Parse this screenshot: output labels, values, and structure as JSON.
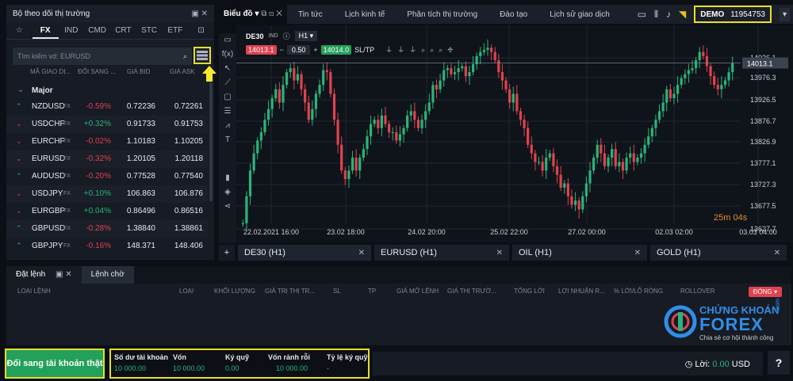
{
  "watch": {
    "title": "Bộ theo dõi thị trường",
    "tabs": [
      "FX",
      "IND",
      "CMD",
      "CRT",
      "STC",
      "ETF"
    ],
    "search_placeholder": "Tìm kiếm vd: EURUSD",
    "col_headers": [
      "MÃ GIAO DỊ...",
      "ĐỔI SANG ...",
      "GIÁ BID",
      "GIÁ ASK"
    ],
    "group": "Major",
    "rows": [
      {
        "dir": "up",
        "sym": "NZDUSD",
        "tag": "FX",
        "chg": "-0.59%",
        "bid": "0.72236",
        "ask": "0.72261"
      },
      {
        "dir": "dn",
        "sym": "USDCHF",
        "tag": "FX",
        "chg": "+0.32%",
        "bid": "0.91733",
        "ask": "0.91753"
      },
      {
        "dir": "dn",
        "sym": "EURCHF",
        "tag": "FX",
        "chg": "-0.02%",
        "bid": "1.10183",
        "ask": "1.10205"
      },
      {
        "dir": "dn",
        "sym": "EURUSD",
        "tag": "FX",
        "chg": "-0.32%",
        "bid": "1.20105",
        "ask": "1.20118"
      },
      {
        "dir": "up",
        "sym": "AUDUSD",
        "tag": "FX",
        "chg": "-0.20%",
        "bid": "0.77528",
        "ask": "0.77540"
      },
      {
        "dir": "dn",
        "sym": "USDJPY",
        "tag": "FX",
        "chg": "+0.10%",
        "bid": "106.863",
        "ask": "106.876"
      },
      {
        "dir": "dn",
        "sym": "EURGBP",
        "tag": "FX",
        "chg": "+0.04%",
        "bid": "0.86496",
        "ask": "0.86516"
      },
      {
        "dir": "up",
        "sym": "GBPUSD",
        "tag": "FX",
        "chg": "-0.28%",
        "bid": "1.38840",
        "ask": "1.38861"
      },
      {
        "dir": "up",
        "sym": "GBPJPY",
        "tag": "FX",
        "chg": "-0.16%",
        "bid": "148.371",
        "ask": "148.406"
      }
    ]
  },
  "topnav": {
    "first": "Biểu đồ",
    "items": [
      "Tin tức",
      "Lịch kinh tế",
      "Phân tích thị trường",
      "Đào tạo",
      "Lịch sử giao dịch"
    ],
    "account_mode": "DEMO",
    "account_id": "11954753"
  },
  "chart": {
    "symbol": "DE30",
    "tag": "IND",
    "timeframe": "H1",
    "sell_price": "14013.1",
    "spread": "0.50",
    "buy_price": "14014.0",
    "sltp": "SL/TP",
    "current_price": "14013.1",
    "countdown": "25m 04s",
    "y_ticks": [
      "14026.1",
      "13976.3",
      "13926.5",
      "13876.7",
      "13826.9",
      "13777.1",
      "13727.3",
      "13677.5",
      "13627.7"
    ],
    "x_ticks": [
      "22.02.2021 16:00",
      "23.02 18:00",
      "24.02 20:00",
      "25.02 22:00",
      "27.02 00:00",
      "02.03 02:00",
      "03.03 04:00"
    ],
    "colors": {
      "up": "#2ab47a",
      "down": "#e0424f",
      "grid": "#1f2530"
    }
  },
  "chart_tabs": [
    {
      "label": "DE30 (H1)"
    },
    {
      "label": "EURUSD (H1)"
    },
    {
      "label": "OIL (H1)"
    },
    {
      "label": "GOLD (H1)"
    }
  ],
  "orders": {
    "tab_active": "Đặt lệnh",
    "tab_pending": "Lệnh chờ",
    "columns": [
      "LOẠI LỆNH",
      "LOẠI",
      "KHỐI LƯỢNG",
      "GIÁ TRỊ THỊ TR...",
      "SL",
      "TP",
      "GIÁ MỞ LỆNH",
      "GIÁ THỊ TRƯỜ...",
      "TỔNG LỜI",
      "LỢI NHUẬN R...",
      "% LỜI/LỖ RÒNG",
      "ROLLOVER"
    ],
    "close_label": "ĐÓNG"
  },
  "logo": {
    "line1": "CHỨNG KHOÁN",
    "line2": "FOREX",
    "dotcom": ".com",
    "tagline": "Chia sẻ cơ hội thành công"
  },
  "footer": {
    "real_account_button": "Đổi sang tài khoản thật",
    "balance_label": "Số dư tài khoản",
    "balance_value": "10 000.00",
    "equity_label": "Vốn",
    "equity_value": "10 000.00",
    "margin_label": "Ký quỹ",
    "margin_value": "0.00",
    "free_label": "Vốn rảnh rỗi",
    "free_value": "10 000.00",
    "ratio_label": "Tỷ lệ ký quỹ",
    "ratio_value": "-",
    "profit_label": "Lời:",
    "profit_value": "0.00",
    "currency": "USD",
    "help": "?"
  }
}
